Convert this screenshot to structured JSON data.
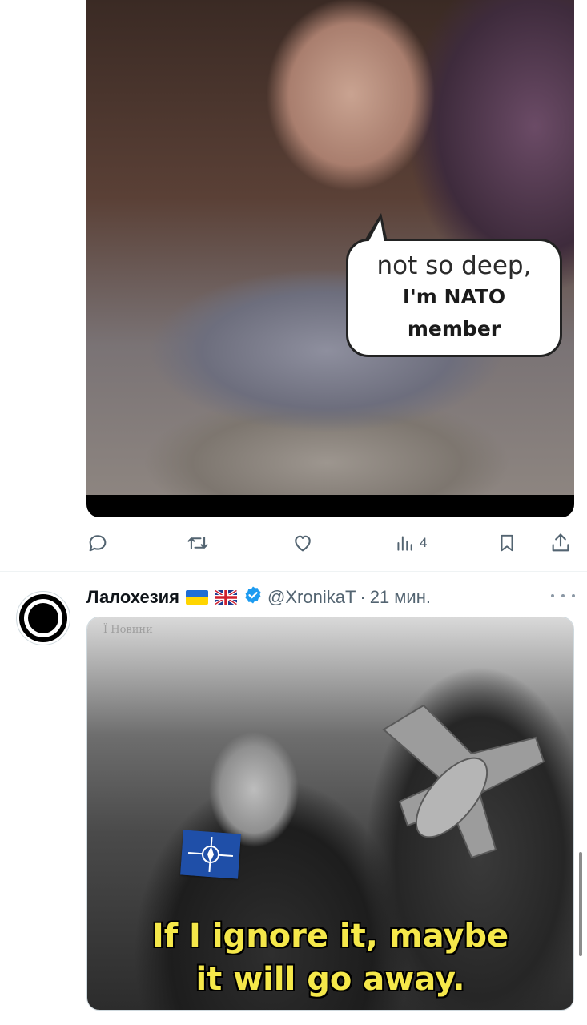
{
  "tweet_top": {
    "media": {
      "bubble_line1": "not so deep,",
      "bubble_line2": "I'm NATO",
      "bubble_line3": "member"
    },
    "actions": {
      "views_count": "4"
    }
  },
  "tweet_bottom": {
    "author_name": "Лалохезия",
    "flags": [
      "ukraine-flag",
      "uk-flag"
    ],
    "handle": "@XronikaT",
    "separator": "·",
    "time": "21 мин.",
    "media": {
      "watermark": "Ї Новини",
      "caption_line1": "If I ignore it, maybe",
      "caption_line2": "it will go away."
    }
  },
  "colors": {
    "icon_gray": "#536471",
    "verified_blue": "#1d9bf0",
    "caption_yellow": "#f5e84a",
    "nato_blue": "#1f4fa8"
  }
}
